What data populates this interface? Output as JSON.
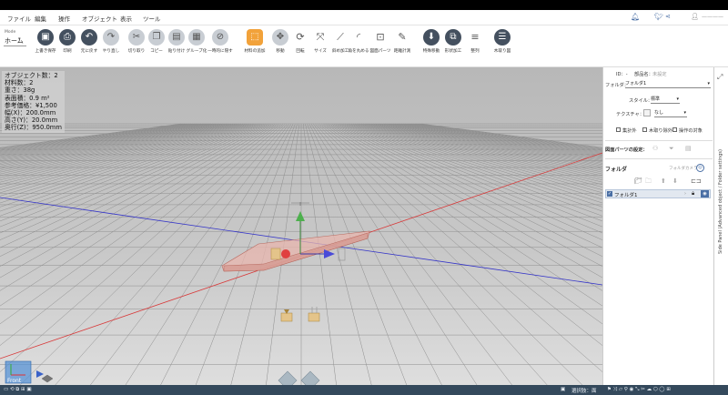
{
  "menu": [
    "ファイル",
    "編集",
    "操作",
    "オブジェクト",
    "表示",
    "ツール"
  ],
  "mode": {
    "label": "Mode",
    "value": "ホーム"
  },
  "toolbar": [
    {
      "id": "overwrite-save",
      "label": "上書き保存",
      "icon": "save-icon",
      "glyph": "▣",
      "style": "dark"
    },
    {
      "id": "print",
      "label": "印刷",
      "icon": "print-icon",
      "glyph": "⎙",
      "style": "dark"
    },
    {
      "id": "undo",
      "label": "元に戻す",
      "icon": "undo-icon",
      "glyph": "↶",
      "style": "dark"
    },
    {
      "id": "redo",
      "label": "やり直し",
      "icon": "redo-icon",
      "glyph": "↷",
      "style": "light"
    },
    {
      "id": "cut",
      "label": "切り取り",
      "icon": "scissors-icon",
      "glyph": "✂",
      "style": "light"
    },
    {
      "id": "copy",
      "label": "コピー",
      "icon": "copy-icon",
      "glyph": "❐",
      "style": "light"
    },
    {
      "id": "paste",
      "label": "貼り付け",
      "icon": "paste-icon",
      "glyph": "▤",
      "style": "light"
    },
    {
      "id": "group",
      "label": "グループ化",
      "icon": "group-icon",
      "glyph": "▦",
      "style": "light"
    },
    {
      "id": "temp-hide",
      "label": "一時的に隠す",
      "icon": "eye-hide-icon",
      "glyph": "⊘",
      "style": "light"
    },
    {
      "id": "add-material",
      "label": "材料の追加",
      "icon": "add-material-icon",
      "glyph": "⬚",
      "style": "orange"
    },
    {
      "id": "move",
      "label": "移動",
      "icon": "move-icon",
      "glyph": "✥",
      "style": "light"
    },
    {
      "id": "rotate",
      "label": "回転",
      "icon": "rotate-icon",
      "glyph": "⟳",
      "style": "none"
    },
    {
      "id": "size",
      "label": "サイズ",
      "icon": "resize-icon",
      "glyph": "⤧",
      "style": "none"
    },
    {
      "id": "edge-process",
      "label": "斜め加工",
      "icon": "bevel-icon",
      "glyph": "⟋",
      "style": "none"
    },
    {
      "id": "round-corner",
      "label": "角を丸める",
      "icon": "round-corner-icon",
      "glyph": "◜",
      "style": "none"
    },
    {
      "id": "drawing-parts",
      "label": "図面パーツ",
      "icon": "drawing-parts-icon",
      "glyph": "⊡",
      "style": "none"
    },
    {
      "id": "measure",
      "label": "距離計測",
      "icon": "pencil-icon",
      "glyph": "✎",
      "style": "none"
    },
    {
      "id": "special-move",
      "label": "特殊移動",
      "icon": "download-icon",
      "glyph": "⬇",
      "style": "dark"
    },
    {
      "id": "shape-process",
      "label": "形状加工",
      "icon": "shape-icon",
      "glyph": "⧉",
      "style": "dark"
    },
    {
      "id": "align",
      "label": "整列",
      "icon": "align-icon",
      "glyph": "≡",
      "style": "none"
    },
    {
      "id": "cut-diagram",
      "label": "木取り図",
      "icon": "cut-diagram-icon",
      "glyph": "☰",
      "style": "dark"
    }
  ],
  "stats": [
    "オブジェクト数：2",
    "材料数：2",
    "重さ：38g",
    "表面積：0.9 m²",
    "参考価格：¥1,500",
    "幅(X)：200.0mm",
    "高さ(Y)：20.0mm",
    "奥行(Z)：950.0mm"
  ],
  "panel": {
    "id_label": "ID：-",
    "part_name_label": "部品名：",
    "part_name_value": "未設定",
    "folder_label": "フォルダ：",
    "folder_value": "フォルダ1",
    "style_label": "スタイル：",
    "style_value": "標準",
    "texture_label": "テクスチャ：",
    "texture_value": "なし",
    "checkboxes": [
      "集計外",
      "木取り除外",
      "操作の対象"
    ],
    "drawing_parts_label": "図面パーツの設定：",
    "folder_heading": "フォルダ",
    "folder_camera_label": "フォルダカメラ",
    "folder_item": "フォルダ1",
    "side_tab": "Side Panel (Advanced object / Folder settings)"
  },
  "viewport": {
    "view_label": "Front"
  },
  "status": {
    "mode_text": "選択肢：面"
  },
  "colors": {
    "toolbar_dark": "#44505f",
    "accent_orange": "#f2a23a",
    "statusbar": "#34495c",
    "axis_x": "#e03030",
    "axis_z": "#3030d0"
  }
}
